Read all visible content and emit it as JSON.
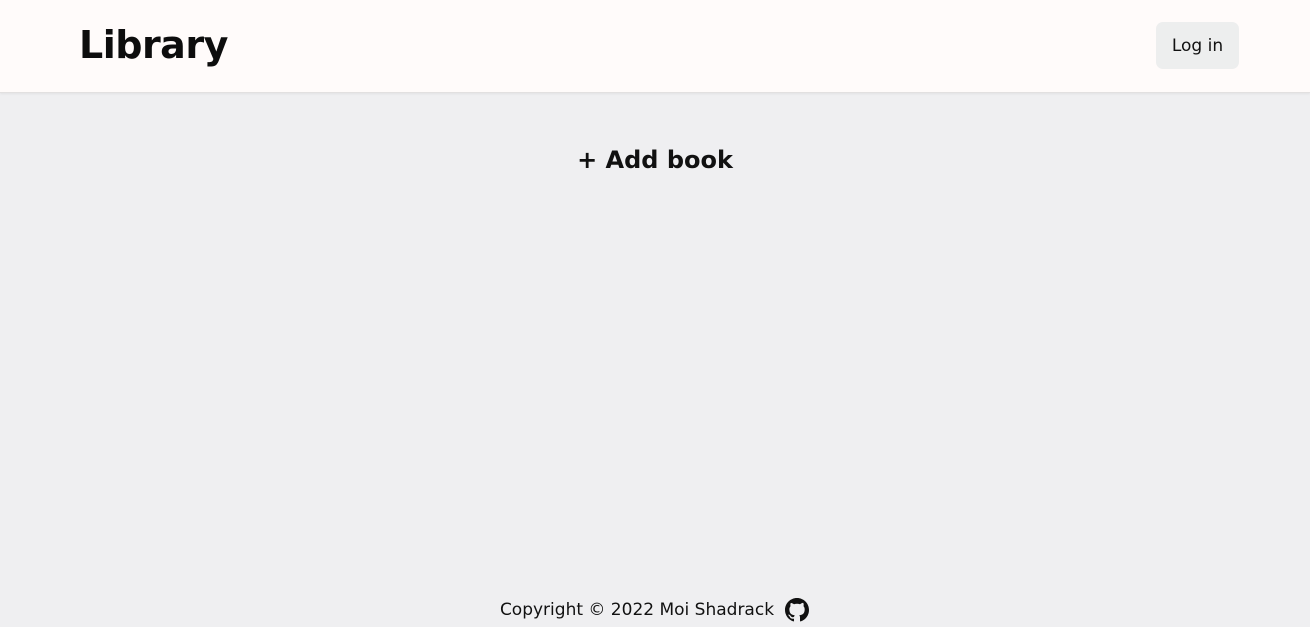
{
  "header": {
    "title": "Library",
    "login_label": "Log in"
  },
  "main": {
    "add_book_label": "+ Add book"
  },
  "footer": {
    "copyright": "Copyright © 2022 Moi Shadrack",
    "github_icon": "github-icon"
  },
  "colors": {
    "page_background": "#efeff1",
    "header_background": "#fffbfa",
    "button_background": "#edeeee",
    "text": "#111111"
  }
}
